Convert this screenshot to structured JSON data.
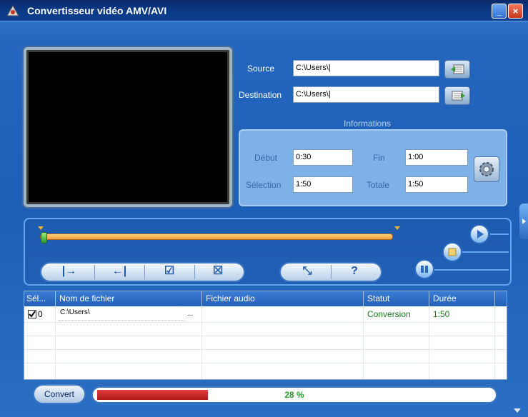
{
  "window": {
    "title": "Convertisseur vidéo AMV/AVI",
    "minimize_label": "_",
    "close_label": "×"
  },
  "source": {
    "label": "Source",
    "value": "C:\\Users\\|"
  },
  "destination": {
    "label": "Destination",
    "value": "C:\\Users\\|"
  },
  "informations": {
    "title": "Informations",
    "debut_label": "Début",
    "debut_value": "0:30",
    "fin_label": "Fin",
    "fin_value": "1:00",
    "selection_label": "Sélection",
    "selection_value": "1:50",
    "totale_label": "Totale",
    "totale_value": "1:50"
  },
  "timeline": {
    "position_fraction": 0.0
  },
  "edit_buttons": [
    "|→",
    "←|",
    "☑",
    "☒"
  ],
  "tool_buttons": [
    "⤡",
    "?"
  ],
  "table": {
    "columns": [
      "Sél...",
      "Nom de fichier",
      "Fichier audio",
      "Statut",
      "Durée"
    ],
    "rows": [
      {
        "checked": true,
        "index": "0",
        "filename": "C:\\Users\\",
        "browse": "...",
        "audio": "",
        "status": "Conversion",
        "duration": "1:50"
      }
    ]
  },
  "convert": {
    "label": "Convert"
  },
  "progress": {
    "value": 28,
    "text": "28 %"
  },
  "colors": {
    "status_text": "#1a7a1a",
    "progress_fill": "#c02020",
    "progress_text": "#2a9a2a"
  }
}
